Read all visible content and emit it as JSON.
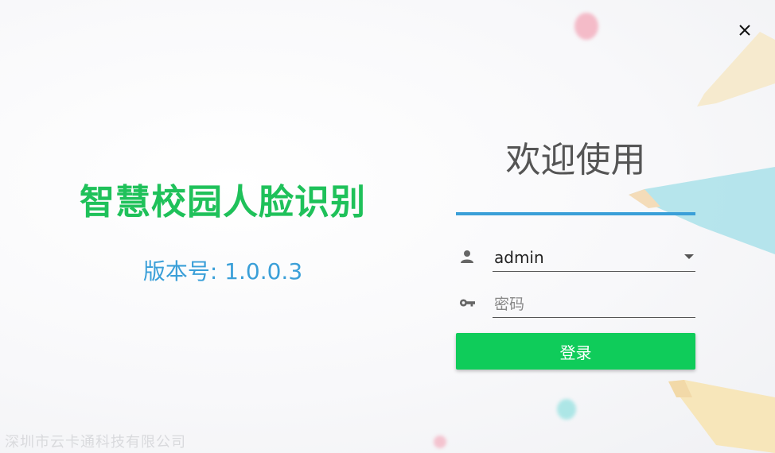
{
  "window": {
    "close_icon": "close-icon"
  },
  "left": {
    "app_title": "智慧校园人脸识别",
    "version_text": "版本号: 1.0.0.3"
  },
  "login": {
    "welcome": "欢迎使用",
    "username_value": "admin",
    "password_placeholder": "密码",
    "login_label": "登录"
  },
  "footer": {
    "company": "深圳市云卡通科技有限公司"
  },
  "colors": {
    "title_green": "#1fc15a",
    "version_blue": "#3a9fd8",
    "button_green": "#0fcc5a",
    "underline_blue": "#3a9fd8"
  }
}
